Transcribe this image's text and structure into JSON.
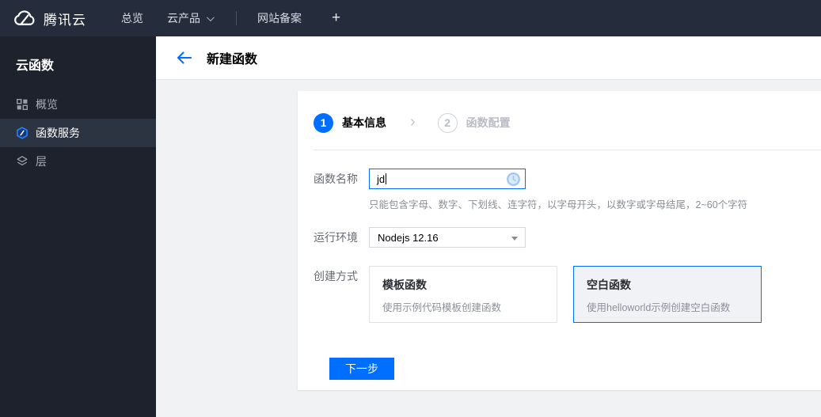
{
  "topbar": {
    "brand": "腾讯云",
    "nav": [
      {
        "label": "总览",
        "has_caret": false
      },
      {
        "label": "云产品",
        "has_caret": true
      },
      {
        "label": "网站备案",
        "has_caret": false
      }
    ],
    "plus_label": "+"
  },
  "sidebar": {
    "title": "云函数",
    "items": [
      {
        "label": "概览",
        "icon": "grid-icon",
        "active": false
      },
      {
        "label": "函数服务",
        "icon": "function-hexagon-icon",
        "active": true
      },
      {
        "label": "层",
        "icon": "layers-icon",
        "active": false
      }
    ]
  },
  "header": {
    "title": "新建函数"
  },
  "wizard": {
    "steps": [
      {
        "number": "1",
        "label": "基本信息",
        "state": "current"
      },
      {
        "number": "2",
        "label": "函数配置",
        "state": "pending"
      }
    ]
  },
  "form": {
    "name": {
      "label": "函数名称",
      "value": "jd",
      "help": "只能包含字母、数字、下划线、连字符，以字母开头，以数字或字母结尾，2~60个字符"
    },
    "runtime": {
      "label": "运行环境",
      "value": "Nodejs 12.16"
    },
    "method": {
      "label": "创建方式",
      "options": [
        {
          "title": "模板函数",
          "desc": "使用示例代码模板创建函数",
          "selected": false
        },
        {
          "title": "空白函数",
          "desc": "使用helloworld示例创建空白函数",
          "selected": true
        }
      ]
    },
    "next_label": "下一步"
  },
  "colors": {
    "accent": "#006eff",
    "topbar_bg": "#252c3b",
    "sidebar_bg": "#1e222c",
    "content_bg": "#f1f2f4"
  }
}
